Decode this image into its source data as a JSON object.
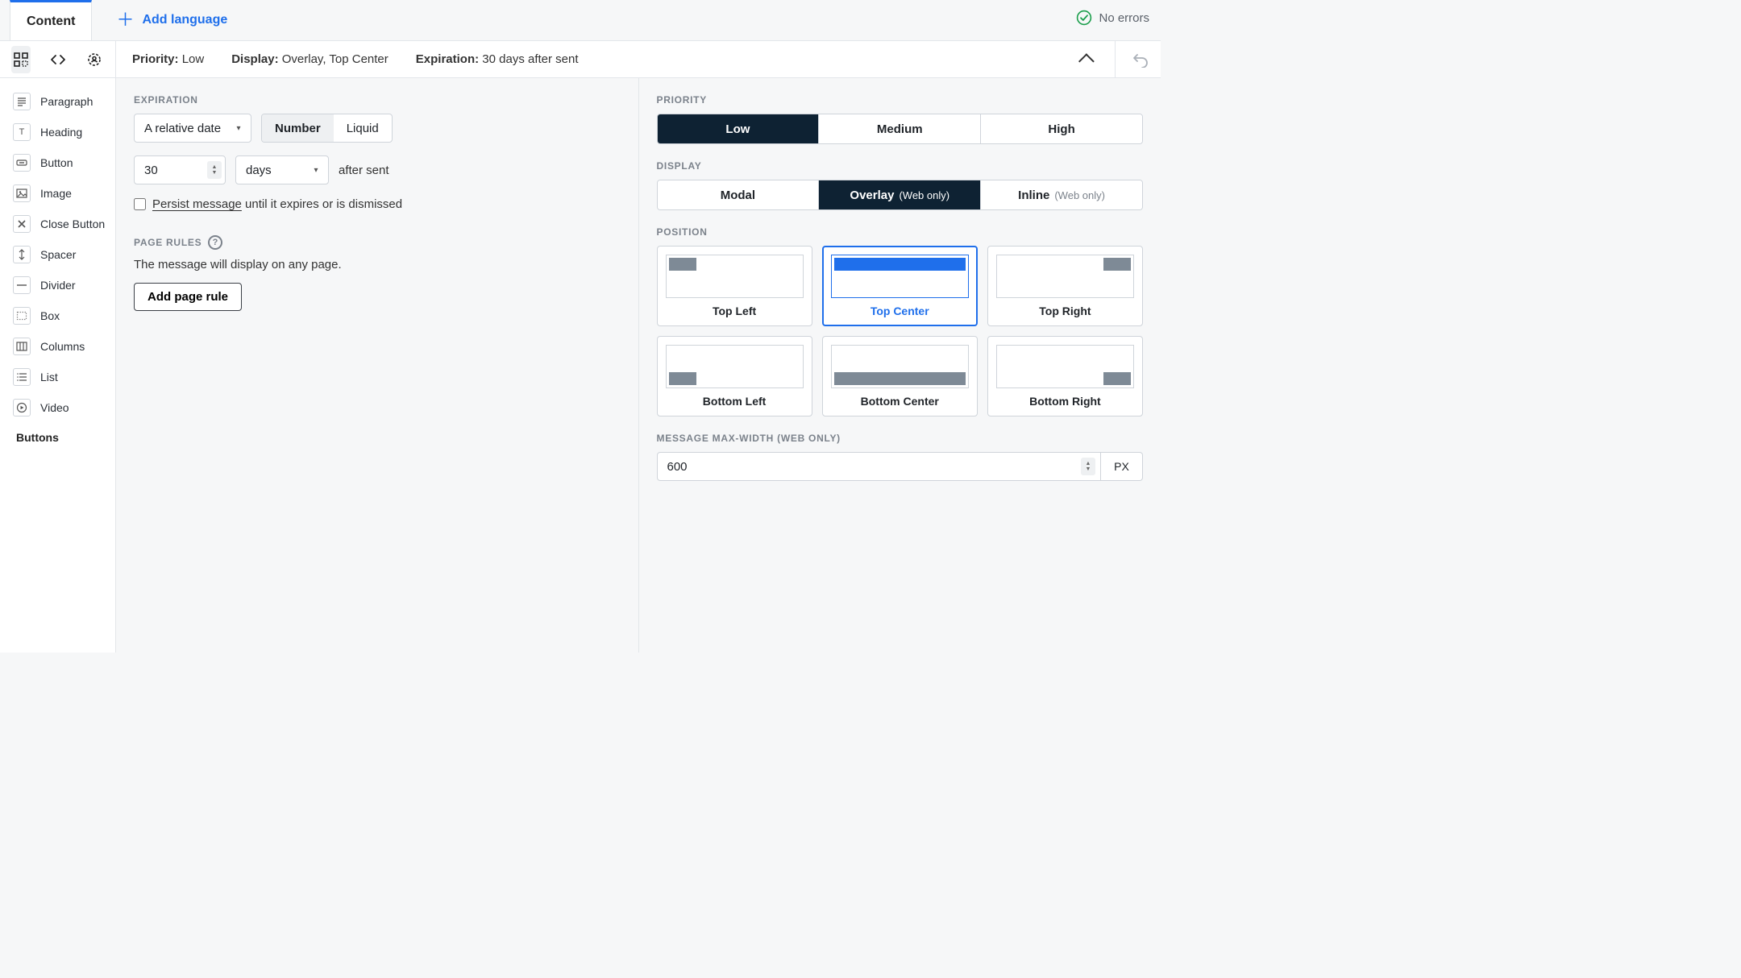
{
  "tabs": {
    "content": "Content",
    "add_language": "Add language"
  },
  "status": {
    "no_errors": "No errors"
  },
  "infobar": {
    "priority_label": "Priority:",
    "priority_value": "Low",
    "display_label": "Display:",
    "display_value": "Overlay, Top Center",
    "expiration_label": "Expiration:",
    "expiration_value": "30 days after sent"
  },
  "elements": {
    "items": [
      {
        "label": "Paragraph"
      },
      {
        "label": "Heading"
      },
      {
        "label": "Button"
      },
      {
        "label": "Image"
      },
      {
        "label": "Close Button"
      },
      {
        "label": "Spacer"
      },
      {
        "label": "Divider"
      },
      {
        "label": "Box"
      },
      {
        "label": "Columns"
      },
      {
        "label": "List"
      },
      {
        "label": "Video"
      }
    ],
    "section": "Buttons"
  },
  "expiration": {
    "label": "EXPIRATION",
    "mode": "A relative date",
    "format_number": "Number",
    "format_liquid": "Liquid",
    "value": "30",
    "unit": "days",
    "suffix": "after sent",
    "persist_label": "Persist message",
    "persist_rest": "until it expires or is dismissed"
  },
  "page_rules": {
    "label": "PAGE RULES",
    "desc": "The message will display on any page.",
    "button": "Add page rule"
  },
  "priority": {
    "label": "PRIORITY",
    "low": "Low",
    "medium": "Medium",
    "high": "High"
  },
  "display": {
    "label": "DISPLAY",
    "modal": "Modal",
    "overlay": "Overlay",
    "overlay_sub": "(Web only)",
    "inline": "Inline",
    "inline_sub": "(Web only)"
  },
  "position": {
    "label": "POSITION",
    "tl": "Top Left",
    "tc": "Top Center",
    "tr": "Top Right",
    "bl": "Bottom Left",
    "bc": "Bottom Center",
    "br": "Bottom Right"
  },
  "maxwidth": {
    "label": "MESSAGE MAX-WIDTH (WEB ONLY)",
    "value": "600",
    "unit": "PX"
  }
}
